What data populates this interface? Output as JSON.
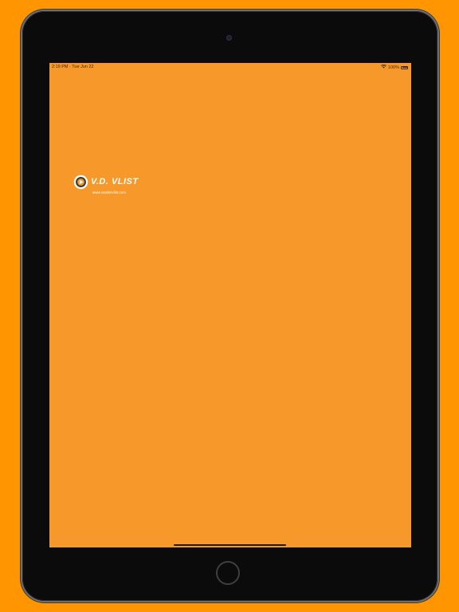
{
  "status_bar": {
    "time": "2:19 PM · Tue Jun 22",
    "battery": "100%",
    "wifi_icon": "wifi-icon",
    "battery_icon": "battery-icon"
  },
  "logo": {
    "wordmark": "V.D. VLIST",
    "url": "www.vandervlist.com",
    "emblem_icon": "vdvlist-emblem"
  },
  "colors": {
    "page_background": "#FF9500",
    "screen_background": "#F7992A",
    "device_frame": "#0B0B0B",
    "logo_text": "#FFFFFF"
  }
}
